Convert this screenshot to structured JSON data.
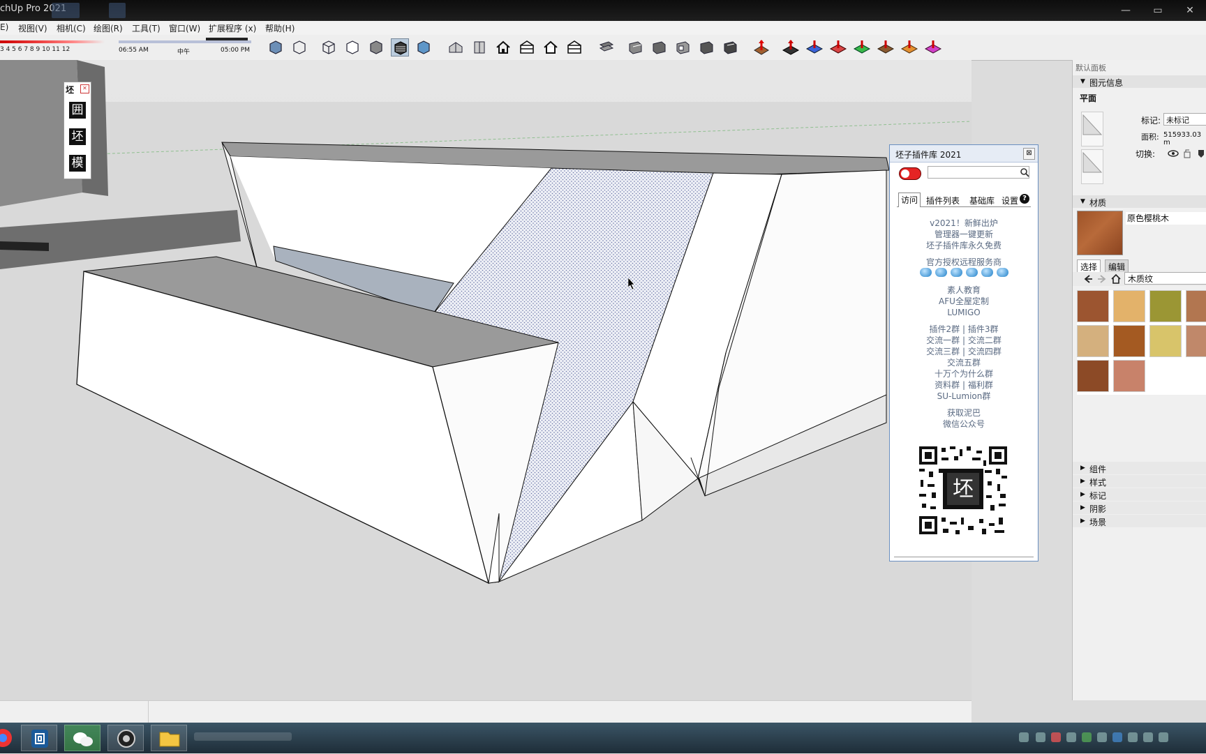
{
  "window": {
    "title": "chUp Pro 2021",
    "controls": [
      "—",
      "▭",
      "✕"
    ]
  },
  "menu": [
    {
      "label": "E)"
    },
    {
      "label": "视图(V)"
    },
    {
      "label": "相机(C)"
    },
    {
      "label": "绘图(R)"
    },
    {
      "label": "工具(T)"
    },
    {
      "label": "窗口(W)"
    },
    {
      "label": "扩展程序 (x)"
    },
    {
      "label": "帮助(H)"
    }
  ],
  "shadow_settings": {
    "month_ticks": "3  4  5  6  7  8  9  10  11  12",
    "time_start": "06:55 AM",
    "time_mid": "中午",
    "time_end": "05:00 PM"
  },
  "toolbar": {
    "icons": [
      "xray-icon",
      "back-edges-icon",
      "wireframe-icon",
      "hidden-line-icon",
      "shaded-icon",
      "shaded-textures-icon",
      "monochrome-icon",
      "iso-view-icon",
      "top-view-icon",
      "front-view-icon",
      "right-view-icon",
      "back-view-icon",
      "left-view-icon",
      "section-plane-icon",
      "section-display-icon",
      "section-cuts-icon",
      "section-fill-icon",
      "section-icon-5",
      "section-icon-6",
      "axes-icon",
      "sandbox-icon-1",
      "sandbox-icon-2",
      "sandbox-icon-3",
      "sandbox-icon-4",
      "sandbox-icon-5",
      "sandbox-icon-6",
      "sandbox-icon-7"
    ],
    "active_index": 5,
    "accent": "#2f6ab0"
  },
  "viewport_tools": {
    "header": "坯",
    "buttons": [
      "囲",
      "坯",
      "模"
    ]
  },
  "plugin_panel": {
    "title": "坯子插件库 2021",
    "close": "⊠",
    "search_placeholder": "",
    "tabs": [
      "访问",
      "插件列表",
      "基础库",
      "设置"
    ],
    "help": "?",
    "blocks": [
      [
        "v2021！新鲜出炉",
        "管理器一键更新",
        "坯子插件库永久免费"
      ],
      [
        "官方授权远程服务商"
      ],
      [
        "素人教育",
        "AFU全屋定制",
        "LUMIGO"
      ],
      [
        "插件2群 | 插件3群",
        "交流一群 | 交流二群",
        "交流三群 | 交流四群",
        "交流五群",
        "十万个为什么群",
        "资料群 | 福利群",
        "SU-Lumion群"
      ],
      [
        "获取泥巴",
        "微信公众号"
      ]
    ],
    "qr_center": "坯"
  },
  "tray": {
    "header": "默认面板",
    "entity_info": {
      "section": "图元信息",
      "type": "平面",
      "tag_label": "标记:",
      "tag_value": "未标记",
      "area_label": "面积:",
      "area_value": "515933.03 m",
      "toggle_label": "切换:"
    },
    "materials": {
      "section": "材质",
      "name": "原色樱桃木",
      "tab_select": "选择",
      "tab_edit": "编辑",
      "library": "木质纹",
      "swatches": [
        "#9c5530",
        "#e3b26a",
        "#9b9634",
        "#b27650",
        "#d4b07e",
        "#a45a22",
        "#d8c46a",
        "#c0886a",
        "#8c4a26",
        "#c8826a"
      ]
    },
    "collapsed_sections": [
      "组件",
      "样式",
      "标记",
      "阴影",
      "场景"
    ]
  },
  "taskbar": {
    "apps": [
      "chrome-icon",
      "sketchup-icon",
      "wechat-icon",
      "obs-icon",
      "file-explorer-icon"
    ]
  }
}
